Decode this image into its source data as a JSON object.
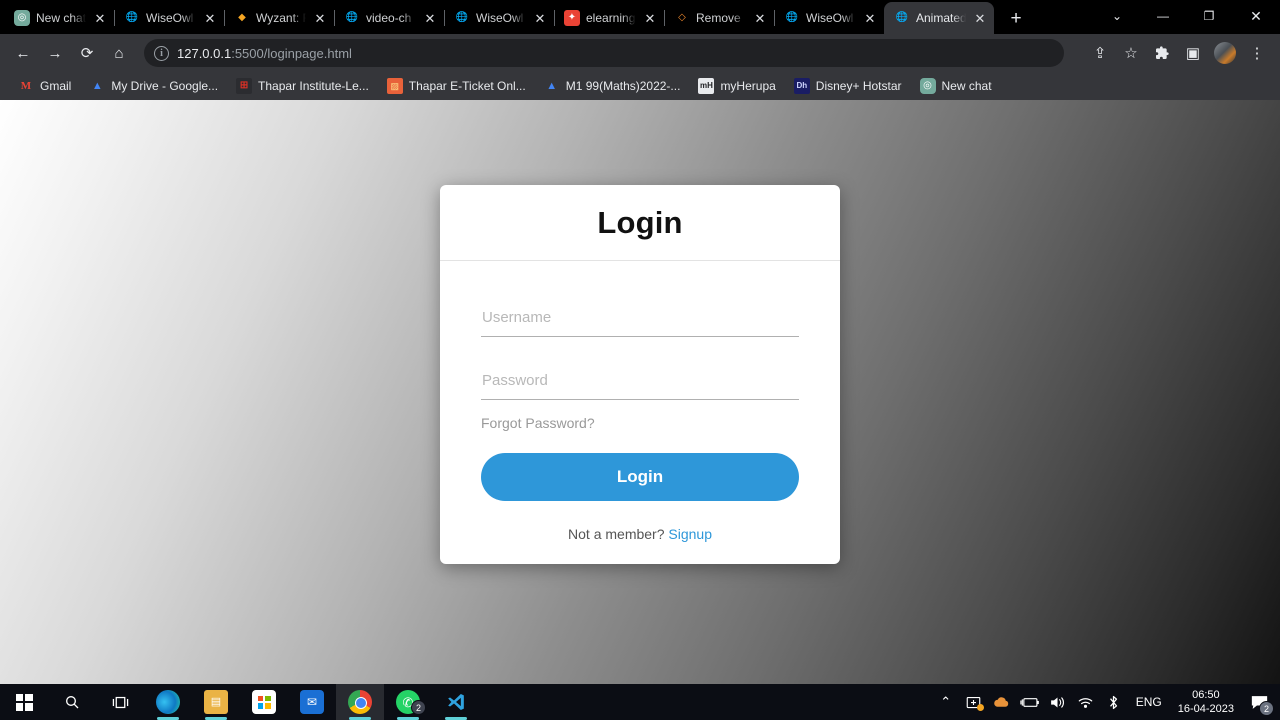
{
  "browser": {
    "tabs": [
      {
        "title": "New chat",
        "favicon": "chatgpt-icon",
        "active": false
      },
      {
        "title": "WiseOwl",
        "favicon": "globe-icon",
        "active": false
      },
      {
        "title": "Wyzant: F",
        "favicon": "wyzant-icon",
        "active": false
      },
      {
        "title": "video-ch",
        "favicon": "globe-icon",
        "active": false
      },
      {
        "title": "WiseOwl",
        "favicon": "globe-icon",
        "active": false
      },
      {
        "title": "elearning",
        "favicon": "elearning-icon",
        "active": false
      },
      {
        "title": "Remove",
        "favicon": "eraser-icon",
        "active": false
      },
      {
        "title": "WiseOwl",
        "favicon": "globe-icon",
        "active": false
      },
      {
        "title": "Animated",
        "favicon": "globe-icon",
        "active": true
      }
    ],
    "new_tab_label": "+",
    "window_controls": {
      "tab_search": "⌄",
      "minimize": "—",
      "maximize": "❐",
      "close": "✕"
    },
    "toolbar": {
      "back": "←",
      "forward": "→",
      "reload": "⟳",
      "home": "⌂",
      "url_host": "127.0.0.1",
      "url_path": ":5500/loginpage.html",
      "share": "⇪",
      "bookmark": "☆",
      "extensions": "🧩",
      "side_panel": "▣",
      "profile": "avatar",
      "menu": "⋮"
    },
    "bookmarks": [
      {
        "label": "Gmail",
        "icon": "gmail-icon"
      },
      {
        "label": "My Drive - Google...",
        "icon": "google-drive-icon"
      },
      {
        "label": "Thapar Institute-Le...",
        "icon": "thapar-icon"
      },
      {
        "label": "Thapar E-Ticket Onl...",
        "icon": "eticket-icon"
      },
      {
        "label": "M1 99(Maths)2022-...",
        "icon": "google-drive-icon"
      },
      {
        "label": "myHerupa",
        "icon": "myherupa-icon"
      },
      {
        "label": "Disney+ Hotstar",
        "icon": "disney-hotstar-icon"
      },
      {
        "label": "New chat",
        "icon": "chatgpt-icon"
      }
    ]
  },
  "page": {
    "card": {
      "title": "Login",
      "username": {
        "placeholder": "Username",
        "value": ""
      },
      "password": {
        "placeholder": "Password",
        "value": ""
      },
      "forgot_label": "Forgot Password?",
      "login_button": "Login",
      "signup_prompt": "Not a member?",
      "signup_link": "Signup"
    },
    "accent_color": "#2e97d9",
    "background": "linear-gradient light-grey to dark-grey"
  },
  "taskbar": {
    "apps": [
      {
        "name": "start",
        "label": ""
      },
      {
        "name": "search",
        "label": "⌕"
      },
      {
        "name": "task-view",
        "label": "▯"
      },
      {
        "name": "edge",
        "label": ""
      },
      {
        "name": "file-explorer",
        "label": "🗀"
      },
      {
        "name": "microsoft-store",
        "label": ""
      },
      {
        "name": "mail",
        "label": "✉"
      },
      {
        "name": "chrome",
        "label": ""
      },
      {
        "name": "whatsapp",
        "label": "✆",
        "badge": "2"
      },
      {
        "name": "vs-code",
        "label": "✖"
      }
    ],
    "tray": {
      "show_hidden": "⌃",
      "language": "ENG",
      "time": "06:50",
      "date": "16-04-2023",
      "notification_badge": "2"
    }
  }
}
